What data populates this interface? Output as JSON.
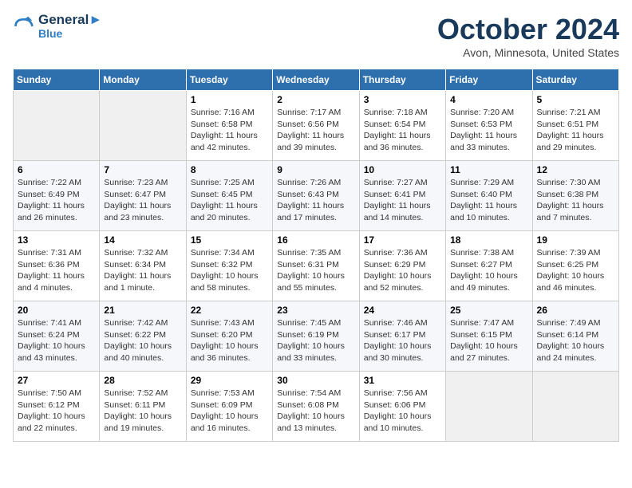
{
  "header": {
    "logo_line1": "General",
    "logo_line2": "Blue",
    "month_title": "October 2024",
    "location": "Avon, Minnesota, United States"
  },
  "days_of_week": [
    "Sunday",
    "Monday",
    "Tuesday",
    "Wednesday",
    "Thursday",
    "Friday",
    "Saturday"
  ],
  "weeks": [
    [
      {
        "num": "",
        "sunrise": "",
        "sunset": "",
        "daylight": ""
      },
      {
        "num": "",
        "sunrise": "",
        "sunset": "",
        "daylight": ""
      },
      {
        "num": "1",
        "sunrise": "Sunrise: 7:16 AM",
        "sunset": "Sunset: 6:58 PM",
        "daylight": "Daylight: 11 hours and 42 minutes."
      },
      {
        "num": "2",
        "sunrise": "Sunrise: 7:17 AM",
        "sunset": "Sunset: 6:56 PM",
        "daylight": "Daylight: 11 hours and 39 minutes."
      },
      {
        "num": "3",
        "sunrise": "Sunrise: 7:18 AM",
        "sunset": "Sunset: 6:54 PM",
        "daylight": "Daylight: 11 hours and 36 minutes."
      },
      {
        "num": "4",
        "sunrise": "Sunrise: 7:20 AM",
        "sunset": "Sunset: 6:53 PM",
        "daylight": "Daylight: 11 hours and 33 minutes."
      },
      {
        "num": "5",
        "sunrise": "Sunrise: 7:21 AM",
        "sunset": "Sunset: 6:51 PM",
        "daylight": "Daylight: 11 hours and 29 minutes."
      }
    ],
    [
      {
        "num": "6",
        "sunrise": "Sunrise: 7:22 AM",
        "sunset": "Sunset: 6:49 PM",
        "daylight": "Daylight: 11 hours and 26 minutes."
      },
      {
        "num": "7",
        "sunrise": "Sunrise: 7:23 AM",
        "sunset": "Sunset: 6:47 PM",
        "daylight": "Daylight: 11 hours and 23 minutes."
      },
      {
        "num": "8",
        "sunrise": "Sunrise: 7:25 AM",
        "sunset": "Sunset: 6:45 PM",
        "daylight": "Daylight: 11 hours and 20 minutes."
      },
      {
        "num": "9",
        "sunrise": "Sunrise: 7:26 AM",
        "sunset": "Sunset: 6:43 PM",
        "daylight": "Daylight: 11 hours and 17 minutes."
      },
      {
        "num": "10",
        "sunrise": "Sunrise: 7:27 AM",
        "sunset": "Sunset: 6:41 PM",
        "daylight": "Daylight: 11 hours and 14 minutes."
      },
      {
        "num": "11",
        "sunrise": "Sunrise: 7:29 AM",
        "sunset": "Sunset: 6:40 PM",
        "daylight": "Daylight: 11 hours and 10 minutes."
      },
      {
        "num": "12",
        "sunrise": "Sunrise: 7:30 AM",
        "sunset": "Sunset: 6:38 PM",
        "daylight": "Daylight: 11 hours and 7 minutes."
      }
    ],
    [
      {
        "num": "13",
        "sunrise": "Sunrise: 7:31 AM",
        "sunset": "Sunset: 6:36 PM",
        "daylight": "Daylight: 11 hours and 4 minutes."
      },
      {
        "num": "14",
        "sunrise": "Sunrise: 7:32 AM",
        "sunset": "Sunset: 6:34 PM",
        "daylight": "Daylight: 11 hours and 1 minute."
      },
      {
        "num": "15",
        "sunrise": "Sunrise: 7:34 AM",
        "sunset": "Sunset: 6:32 PM",
        "daylight": "Daylight: 10 hours and 58 minutes."
      },
      {
        "num": "16",
        "sunrise": "Sunrise: 7:35 AM",
        "sunset": "Sunset: 6:31 PM",
        "daylight": "Daylight: 10 hours and 55 minutes."
      },
      {
        "num": "17",
        "sunrise": "Sunrise: 7:36 AM",
        "sunset": "Sunset: 6:29 PM",
        "daylight": "Daylight: 10 hours and 52 minutes."
      },
      {
        "num": "18",
        "sunrise": "Sunrise: 7:38 AM",
        "sunset": "Sunset: 6:27 PM",
        "daylight": "Daylight: 10 hours and 49 minutes."
      },
      {
        "num": "19",
        "sunrise": "Sunrise: 7:39 AM",
        "sunset": "Sunset: 6:25 PM",
        "daylight": "Daylight: 10 hours and 46 minutes."
      }
    ],
    [
      {
        "num": "20",
        "sunrise": "Sunrise: 7:41 AM",
        "sunset": "Sunset: 6:24 PM",
        "daylight": "Daylight: 10 hours and 43 minutes."
      },
      {
        "num": "21",
        "sunrise": "Sunrise: 7:42 AM",
        "sunset": "Sunset: 6:22 PM",
        "daylight": "Daylight: 10 hours and 40 minutes."
      },
      {
        "num": "22",
        "sunrise": "Sunrise: 7:43 AM",
        "sunset": "Sunset: 6:20 PM",
        "daylight": "Daylight: 10 hours and 36 minutes."
      },
      {
        "num": "23",
        "sunrise": "Sunrise: 7:45 AM",
        "sunset": "Sunset: 6:19 PM",
        "daylight": "Daylight: 10 hours and 33 minutes."
      },
      {
        "num": "24",
        "sunrise": "Sunrise: 7:46 AM",
        "sunset": "Sunset: 6:17 PM",
        "daylight": "Daylight: 10 hours and 30 minutes."
      },
      {
        "num": "25",
        "sunrise": "Sunrise: 7:47 AM",
        "sunset": "Sunset: 6:15 PM",
        "daylight": "Daylight: 10 hours and 27 minutes."
      },
      {
        "num": "26",
        "sunrise": "Sunrise: 7:49 AM",
        "sunset": "Sunset: 6:14 PM",
        "daylight": "Daylight: 10 hours and 24 minutes."
      }
    ],
    [
      {
        "num": "27",
        "sunrise": "Sunrise: 7:50 AM",
        "sunset": "Sunset: 6:12 PM",
        "daylight": "Daylight: 10 hours and 22 minutes."
      },
      {
        "num": "28",
        "sunrise": "Sunrise: 7:52 AM",
        "sunset": "Sunset: 6:11 PM",
        "daylight": "Daylight: 10 hours and 19 minutes."
      },
      {
        "num": "29",
        "sunrise": "Sunrise: 7:53 AM",
        "sunset": "Sunset: 6:09 PM",
        "daylight": "Daylight: 10 hours and 16 minutes."
      },
      {
        "num": "30",
        "sunrise": "Sunrise: 7:54 AM",
        "sunset": "Sunset: 6:08 PM",
        "daylight": "Daylight: 10 hours and 13 minutes."
      },
      {
        "num": "31",
        "sunrise": "Sunrise: 7:56 AM",
        "sunset": "Sunset: 6:06 PM",
        "daylight": "Daylight: 10 hours and 10 minutes."
      },
      {
        "num": "",
        "sunrise": "",
        "sunset": "",
        "daylight": ""
      },
      {
        "num": "",
        "sunrise": "",
        "sunset": "",
        "daylight": ""
      }
    ]
  ]
}
